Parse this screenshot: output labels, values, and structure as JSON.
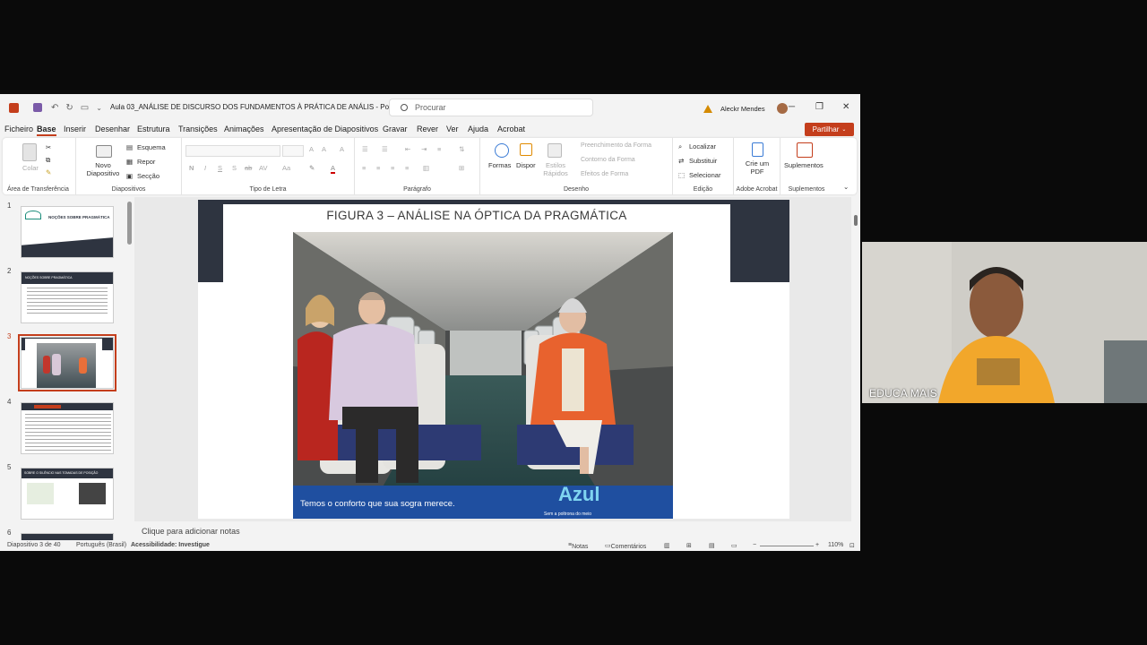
{
  "titlebar": {
    "doc_title": "Aula 03_ANÁLISE DE DISCURSO DOS FUNDAMENTOS À PRÁTICA DE ANÁLIS  -  PowerPoint",
    "search_placeholder": "Procurar",
    "user_name": "Aleckr Mendes",
    "minimize": "─",
    "restore": "❐",
    "close": "✕"
  },
  "menu": {
    "items": [
      "Ficheiro",
      "Base",
      "Inserir",
      "Desenhar",
      "Estrutura",
      "Transições",
      "Animações",
      "Apresentação de Diapositivos",
      "Gravar",
      "Rever",
      "Ver",
      "Ajuda",
      "Acrobat"
    ],
    "active": "Base",
    "share": "Partilhar"
  },
  "ribbon": {
    "clipboard": {
      "label": "Área de Transferência",
      "paste": "Colar"
    },
    "slides": {
      "label": "Diapositivos",
      "new_slide": "Novo Diapositivo",
      "layout": "Esquema",
      "reset": "Repor",
      "section": "Secção"
    },
    "font": {
      "label": "Tipo de Letra",
      "buttons": [
        "N",
        "I",
        "S",
        "S",
        "ab",
        "AV",
        "Aa"
      ]
    },
    "paragraph": {
      "label": "Parágrafo"
    },
    "drawing": {
      "label": "Desenho",
      "shapes": "Formas",
      "arrange": "Dispor",
      "quick_styles": "Estilos Rápidos",
      "fill": "Preenchimento da Forma",
      "outline": "Contorno da Forma",
      "effects": "Efeitos de Forma"
    },
    "editing": {
      "label": "Edição",
      "find": "Localizar",
      "replace": "Substituir",
      "select": "Selecionar"
    },
    "acrobat": {
      "label": "Adobe Acrobat",
      "create_pdf": "Crie um PDF"
    },
    "addins": {
      "label": "Suplementos",
      "button": "Suplementos"
    }
  },
  "thumbnails": [
    {
      "num": "1",
      "text": "NOÇÕES SOBRE PRAGMÁTICA"
    },
    {
      "num": "2",
      "text": "NOÇÕES SOBRE PRAGMÁTICA"
    },
    {
      "num": "3",
      "text": ""
    },
    {
      "num": "4",
      "text": ""
    },
    {
      "num": "5",
      "text": "SOBRE O SILÊNCIO NAS TOMADAS DE POSIÇÃO"
    },
    {
      "num": "6",
      "text": ""
    }
  ],
  "slide": {
    "title": "FIGURA 3 – ANÁLISE NA ÓPTICA DA PRAGMÁTICA",
    "ad_caption": "Temos o conforto que sua sogra merece.",
    "ad_brand": "Azul",
    "ad_tagline": "Sem a poltrona do meio"
  },
  "notes": {
    "placeholder": "Clique para adicionar notas"
  },
  "status": {
    "slide_count": "Diapositivo 3 de 40",
    "language": "Português (Brasil)",
    "accessibility": "Acessibilidade: Investigue",
    "notes": "Notas",
    "comments": "Comentários",
    "zoom": "110%"
  },
  "webcam": {
    "label": "EDUCA MAIS"
  }
}
